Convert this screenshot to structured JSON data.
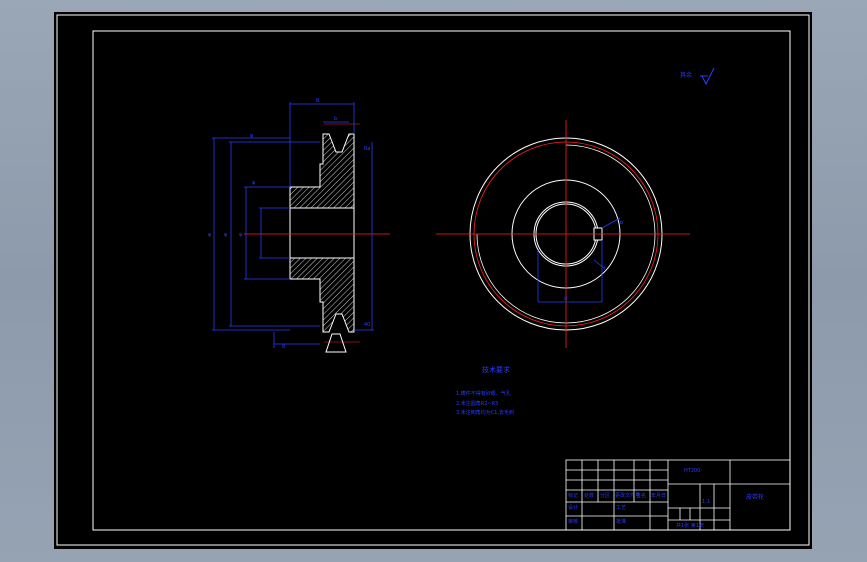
{
  "drawing": {
    "notes_title": "技术要求",
    "notes": [
      "1.铸件不得有砂眼、气孔",
      "2.未注圆角R2~R3",
      "3.未注倒角均为C1,去毛刺"
    ],
    "roughness_note": "其余",
    "title_block": {
      "part_name": "皮带轮",
      "material": "HT200",
      "scale": "1:1",
      "sheet": "共1张 第1张",
      "rows": [
        "标记",
        "处数",
        "分区",
        "更改文件号",
        "签名",
        "年月日"
      ],
      "roles": [
        "设计",
        "审核",
        "工艺",
        "批准"
      ]
    }
  },
  "colors": {
    "background": "#000000",
    "frame": "#ffffff",
    "outline": "#ffffff",
    "dimension": "#2a3cff",
    "centerline": "#ff2020",
    "hatch": "#ffffff"
  }
}
